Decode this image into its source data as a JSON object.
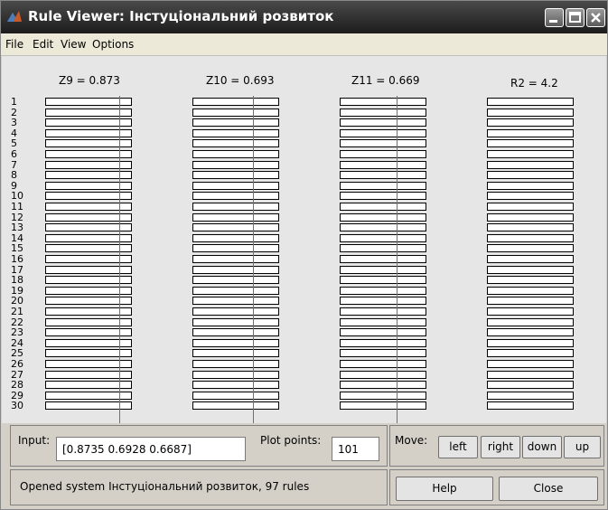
{
  "window": {
    "title": "Rule Viewer: Інстуціональний розвиток"
  },
  "menu": [
    "File",
    "Edit",
    "View",
    "Options"
  ],
  "columns": [
    {
      "label": "Z9 = 0.873",
      "input_value": 0.873
    },
    {
      "label": "Z10 = 0.693",
      "input_value": 0.693
    },
    {
      "label": "Z11 = 0.669",
      "input_value": 0.669
    },
    {
      "label": "R2 = 4.2",
      "output_value": 4.2
    }
  ],
  "visible_rule_numbers": [
    "1",
    "2",
    "3",
    "4",
    "5",
    "6",
    "7",
    "8",
    "9",
    "10",
    "11",
    "12",
    "13",
    "14",
    "15",
    "16",
    "17",
    "18",
    "19",
    "20",
    "21",
    "22",
    "23",
    "24",
    "25",
    "26",
    "27",
    "28",
    "29",
    "30"
  ],
  "controls": {
    "input_label": "Input:",
    "input_value": "[0.8735 0.6928 0.6687]",
    "plot_points_label": "Plot points:",
    "plot_points_value": "101",
    "move_label": "Move:",
    "left": "left",
    "right": "right",
    "down": "down",
    "up": "up",
    "help": "Help",
    "close": "Close"
  },
  "status": "Opened system Інстуціональний розвиток, 97 rules",
  "colors": {
    "titlebar": "#2a2a2a",
    "plot_background": "#e6e6e6",
    "panel": "#d4d0c8",
    "input_line": "#707070",
    "fill": "#b0b0b0"
  }
}
